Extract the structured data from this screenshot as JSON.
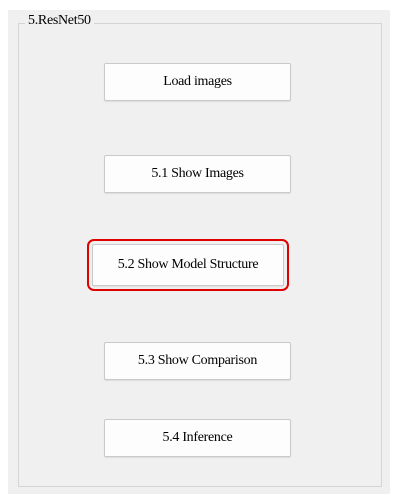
{
  "groupbox": {
    "title": "5.ResNet50"
  },
  "buttons": {
    "load_images": "Load images",
    "show_images": "5.1 Show Images",
    "show_model_structure": "5.2 Show Model Structure",
    "show_comparison": "5.3 Show Comparison",
    "inference": "5.4 Inference"
  },
  "colors": {
    "panel_background": "#f0f0f0",
    "focus_highlight": "#e00000"
  }
}
